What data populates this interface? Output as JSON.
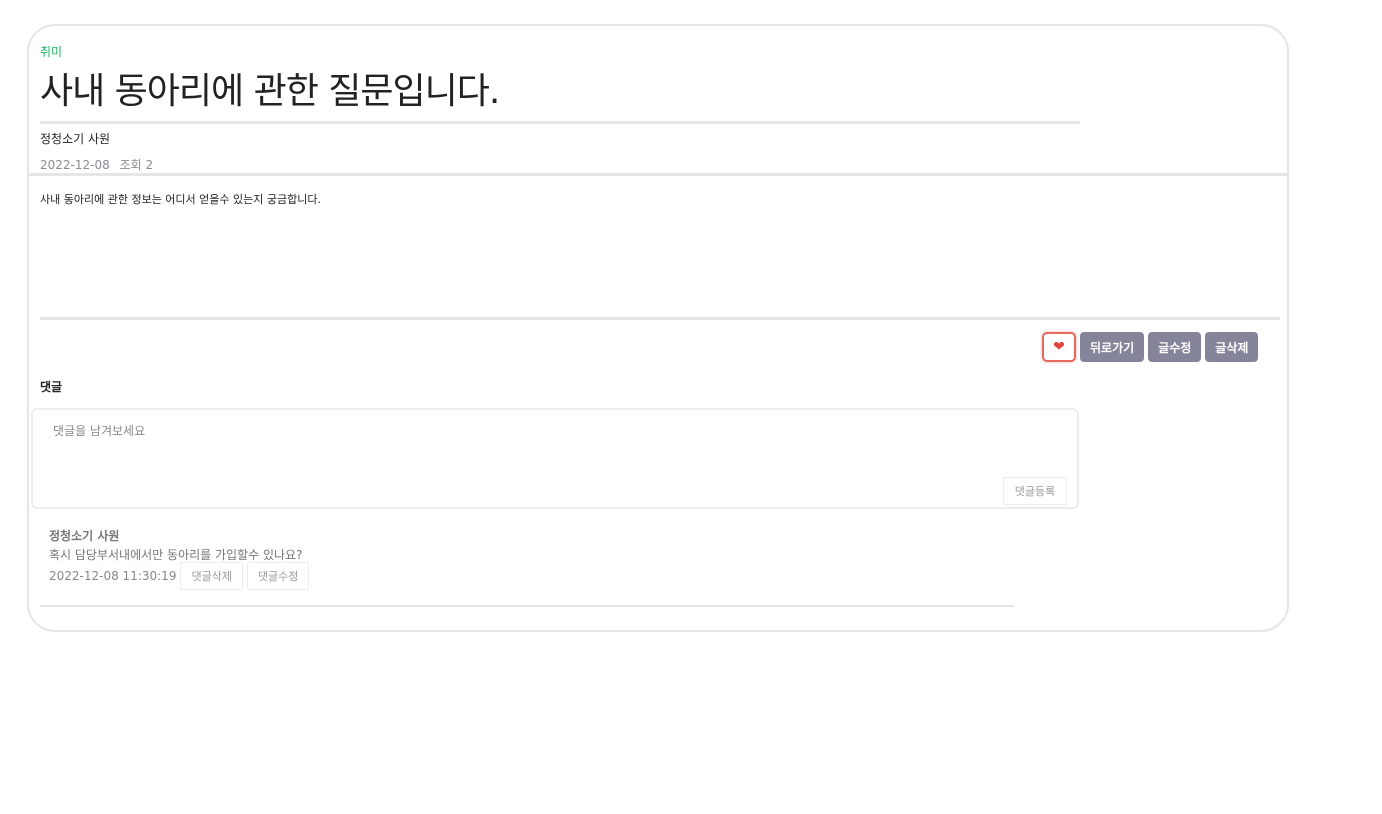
{
  "post": {
    "category": "취미",
    "title": "사내 동아리에 관한 질문입니다.",
    "author": "정청소기 사원",
    "date": "2022-12-08",
    "views": "조회 2",
    "content": "사내 동아리에 관한 정보는 어디서 얻을수 있는지 궁금합니다."
  },
  "actions": {
    "like_icon": "heart-icon",
    "back_label": "뒤로가기",
    "edit_label": "글수정",
    "delete_label": "글삭제"
  },
  "comments_section": {
    "heading": "댓글",
    "input_placeholder": "댓글을 남겨보세요",
    "submit_label": "댓글등록",
    "items": [
      {
        "author": "정청소기 사원",
        "text": "혹시 담당부서내에서만 동아리를 가입할수 있나요?",
        "timestamp": "2022-12-08 11:30:19",
        "delete_label": "댓글삭제",
        "edit_label": "댓글수정"
      }
    ]
  },
  "colors": {
    "category": "#1fb55e",
    "button_grey": "#84849a",
    "like_red": "#e0453b"
  }
}
